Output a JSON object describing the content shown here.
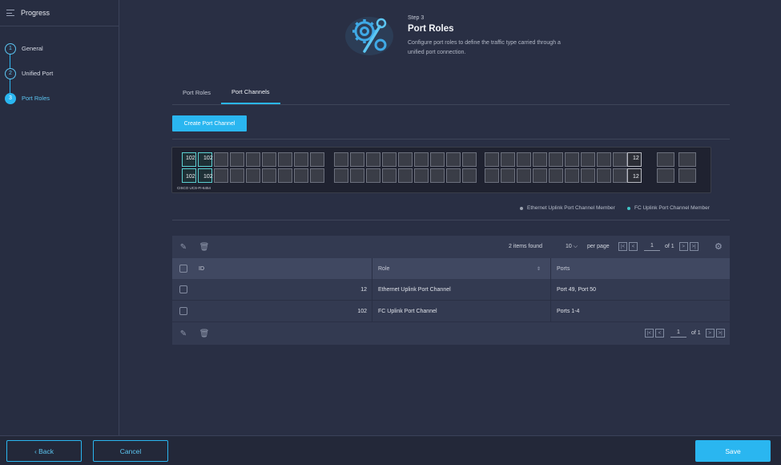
{
  "sidebar": {
    "title": "Progress",
    "steps": [
      {
        "num": "1",
        "label": "General"
      },
      {
        "num": "2",
        "label": "Unified Port"
      },
      {
        "num": "3",
        "label": "Port Roles"
      }
    ]
  },
  "header": {
    "step": "Step 3",
    "title": "Port Roles",
    "description": "Configure port roles to define the traffic type carried through a unified port connection."
  },
  "tabs": [
    {
      "label": "Port Roles"
    },
    {
      "label": "Port Channels"
    }
  ],
  "create_button": "Create Port Channel",
  "switch": {
    "model_label": "CISCO UCS-FI-6454",
    "fc_ports": [
      "102",
      "102",
      "102",
      "102"
    ],
    "eth_ports": [
      "12",
      "12"
    ]
  },
  "legend": {
    "eth": "Ethernet Uplink Port Channel Member",
    "fc": "FC Uplink Port Channel Member",
    "eth_color": "#9aa0ad",
    "fc_color": "#3fc4c6"
  },
  "table": {
    "items_found": "2 items found",
    "per_page_value": "10",
    "per_page_label": "per page",
    "page": "1",
    "of_pages": "of 1",
    "columns": {
      "id": "ID",
      "role": "Role",
      "ports": "Ports"
    },
    "rows": [
      {
        "id": "12",
        "role": "Ethernet Uplink Port Channel",
        "ports": "Port 49, Port 50"
      },
      {
        "id": "102",
        "role": "FC Uplink Port Channel",
        "ports": "Ports 1-4"
      }
    ]
  },
  "footer": {
    "back": "Back",
    "cancel": "Cancel",
    "save": "Save"
  },
  "colors": {
    "accent": "#2ab6f0",
    "background": "#292f44"
  }
}
